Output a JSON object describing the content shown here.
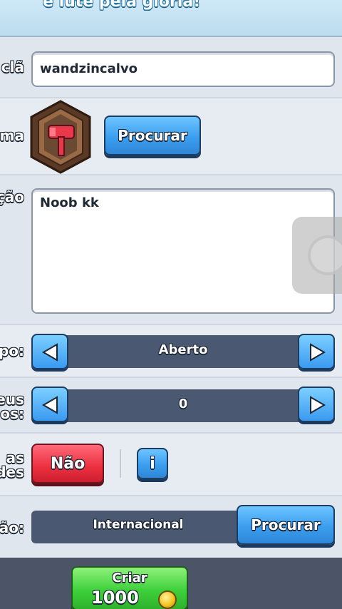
{
  "header": {
    "text": "e lute pela glória!"
  },
  "name_row": {
    "label": "clã",
    "value": "wandzincalvo"
  },
  "emblem_row": {
    "label": "ema",
    "button_label": "Procurar",
    "emblem_icon": "hammer-shield-icon"
  },
  "description_row": {
    "label": "ção",
    "value": "Noob kk"
  },
  "type_row": {
    "label": "po:",
    "value": "Aberto"
  },
  "trophies_row": {
    "label_line1": "eus",
    "label_line2": "dos:",
    "value": "0"
  },
  "family_row": {
    "label_line1": "as",
    "label_line2": "des",
    "toggle_label": "Não",
    "info_label": "i"
  },
  "location_row": {
    "label": "ão:",
    "value": "Internacional",
    "button_label": "Procurar"
  },
  "create_button": {
    "label": "Criar",
    "cost": "1000",
    "coin_icon": "gold-coin-icon"
  },
  "colors": {
    "blue": "#3c9ef0",
    "red": "#ec2f3f",
    "green": "#3ed13b",
    "selector": "#4a5872"
  }
}
